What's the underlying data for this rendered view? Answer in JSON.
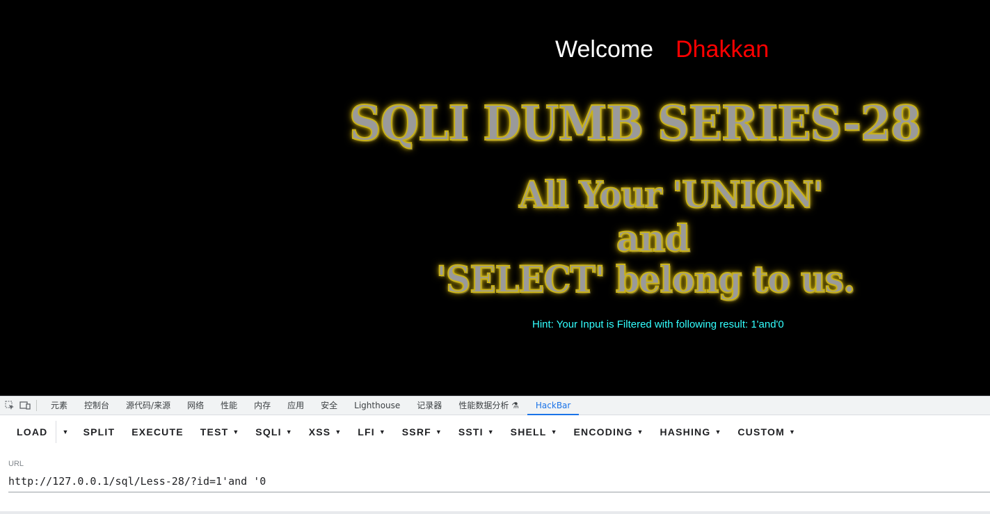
{
  "page": {
    "welcome": "Welcome",
    "name": "Dhakkan",
    "title": "SQLI DUMB SERIES-28",
    "tagline_1": "All Your 'UNION'",
    "tagline_2": "and",
    "tagline_3": "'SELECT' belong to us.",
    "hint": "Hint: Your Input is Filtered with following result: 1'and'0"
  },
  "devtools": {
    "tabs": [
      "元素",
      "控制台",
      "源代码/来源",
      "网络",
      "性能",
      "内存",
      "应用",
      "安全",
      "Lighthouse",
      "记录器",
      "性能数据分析 ⚗",
      "HackBar"
    ],
    "active_tab": "HackBar",
    "icons": [
      "inspect-icon",
      "device-toolbar-icon"
    ]
  },
  "hackbar": {
    "load": "LOAD",
    "split": "SPLIT",
    "execute": "EXECUTE",
    "test": "TEST",
    "sqli": "SQLI",
    "xss": "XSS",
    "lfi": "LFI",
    "ssrf": "SSRF",
    "ssti": "SSTI",
    "shell": "SHELL",
    "encoding": "ENCODING",
    "hashing": "HASHING",
    "custom": "CUSTOM",
    "url_label": "URL",
    "url_value": "http://127.0.0.1/sql/Less-28/?id=1'and '0"
  }
}
